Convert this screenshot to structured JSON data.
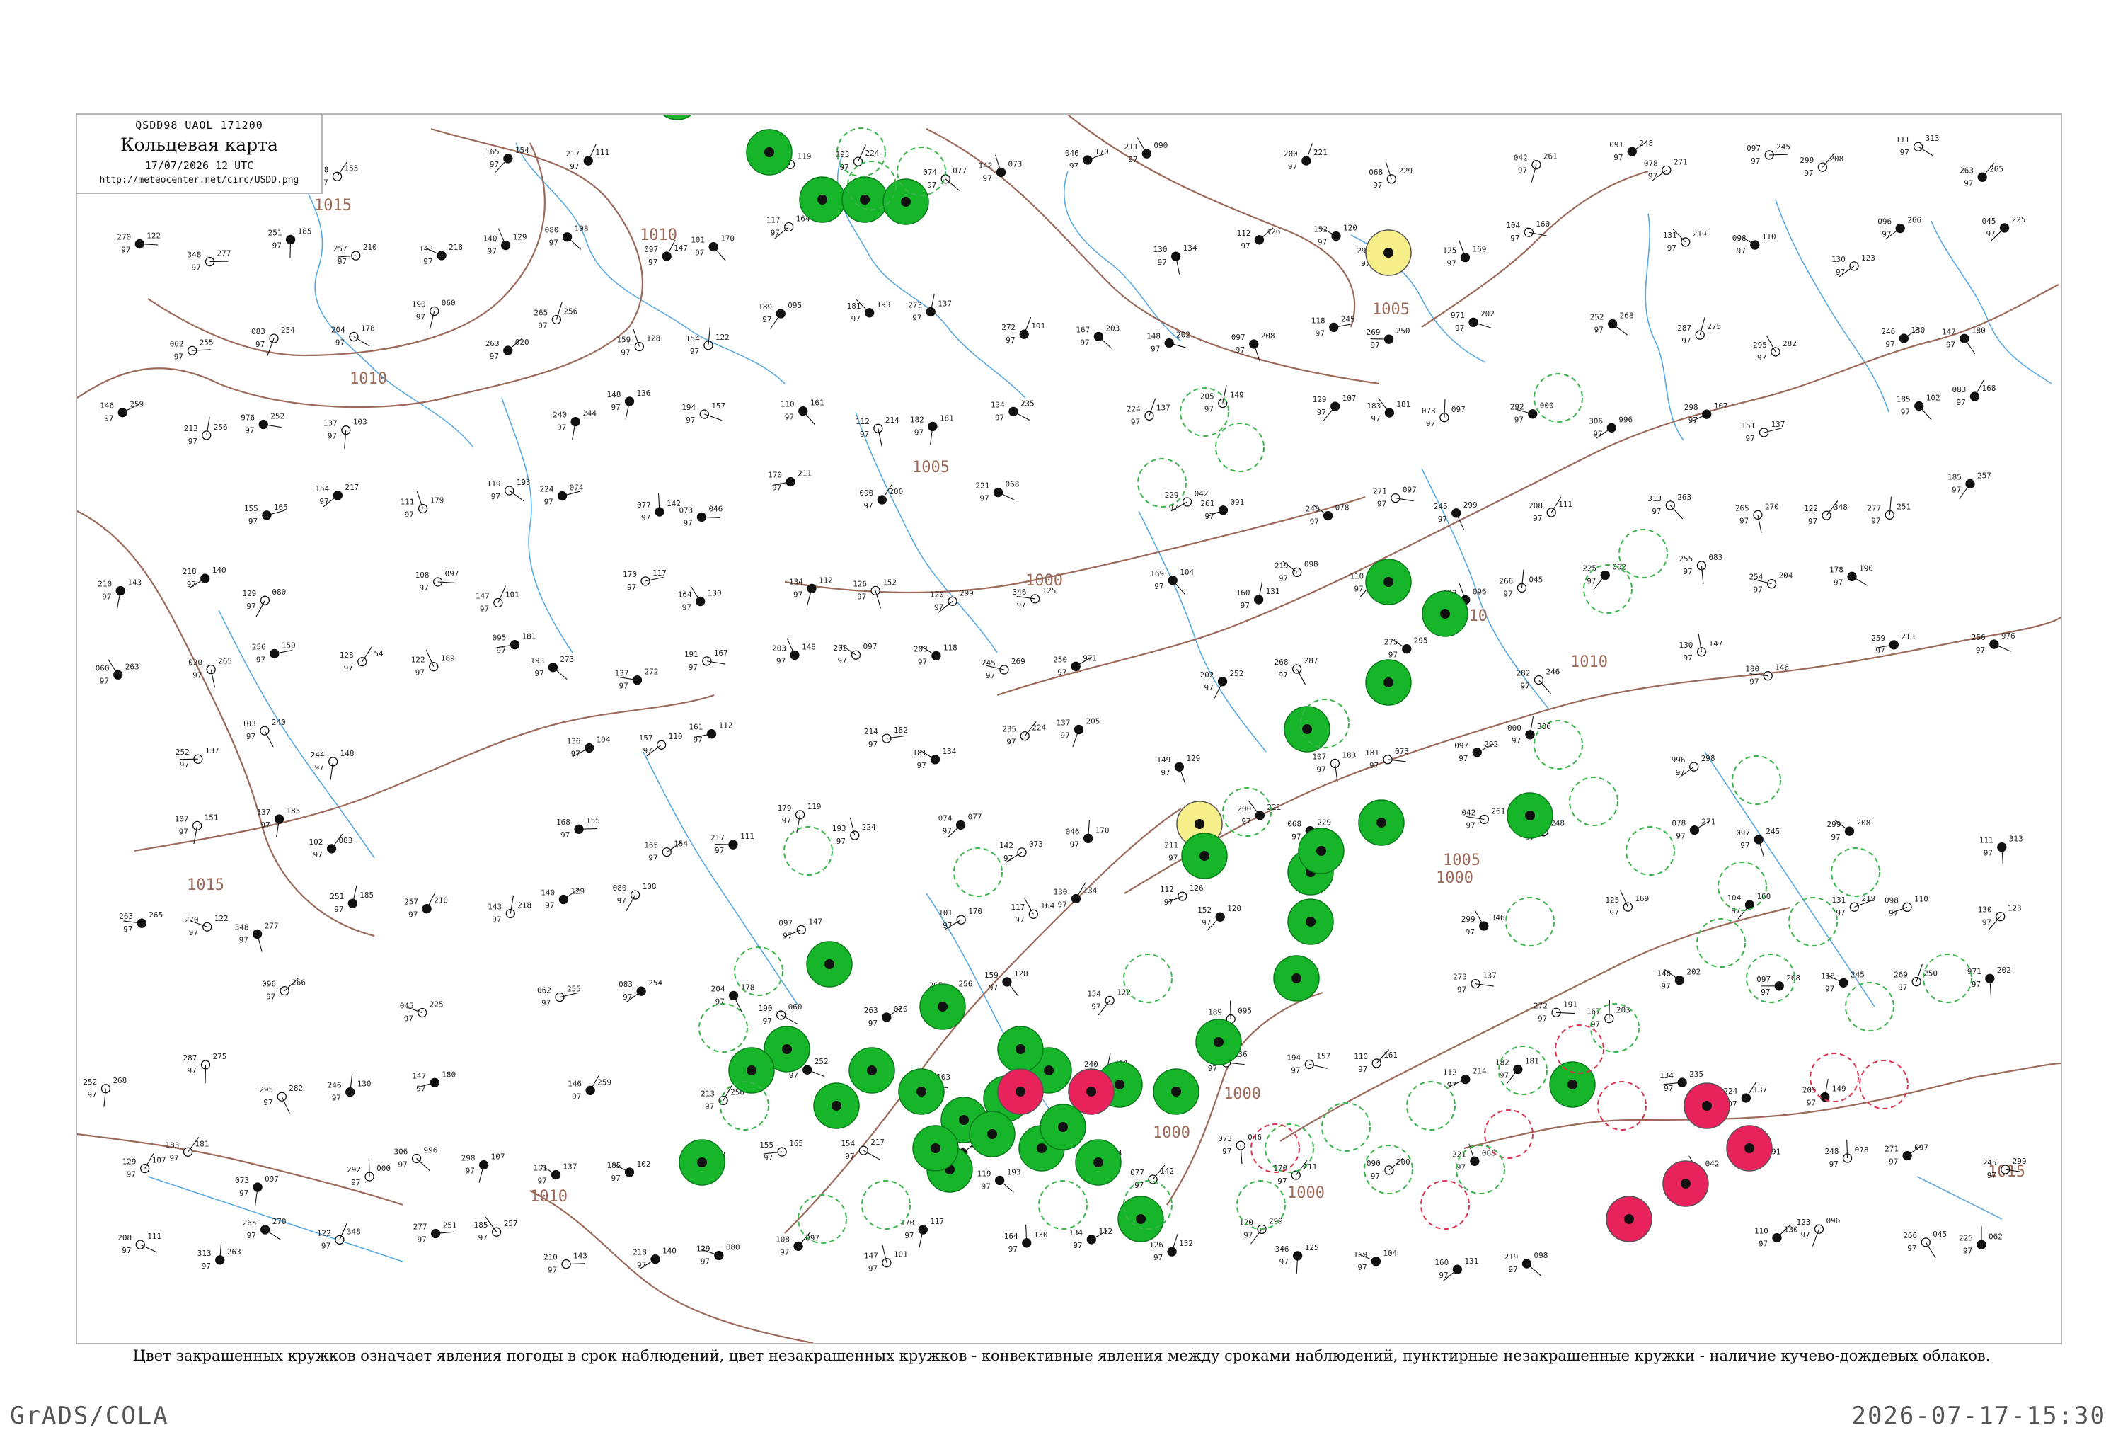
{
  "header": {
    "code": "QSDD98  UAOL  171200",
    "title": "Кольцевая карта",
    "datetime": "17/07/2026 12 UTC",
    "url": "http://meteocenter.net/circ/USDD.png"
  },
  "caption": "Цвет закрашенных кружков означает явления погоды в срок наблюдений, цвет незакрашенных кружков - конвективные явления между сроками наблюдений, пунктирные незакрашенные кружки - наличие кучево-дождевых облаков.",
  "footer": {
    "left": "GrADS/COLA",
    "right": "2026-07-17-15:30"
  },
  "colors": {
    "isobar": "#9b6a5a",
    "river": "#5aa9e0",
    "green_fill": "#17b52a",
    "red_fill": "#e8225a",
    "yellow_fill": "#f7f08a",
    "cyan_fill": "#3de0c8",
    "green_dashed": "#39b54a",
    "red_dashed": "#d9334f"
  },
  "isobar_labels": [
    "1015",
    "1010",
    "1010",
    "1005",
    "1010",
    "1010",
    "1005",
    "1000",
    "1015",
    "1015",
    "1010",
    "1005",
    "1000",
    "1000",
    "1000",
    "1000",
    "1015"
  ],
  "station_values": [
    "107",
    "151",
    "137",
    "185",
    "102",
    "083",
    "168",
    "155",
    "165",
    "154",
    "217",
    "111",
    "179",
    "119",
    "193",
    "224",
    "074",
    "077",
    "142",
    "073",
    "046",
    "170",
    "211",
    "090",
    "200",
    "221",
    "068",
    "229",
    "042",
    "261",
    "091",
    "248",
    "078",
    "271",
    "097",
    "245",
    "299",
    "208",
    "111",
    "313",
    "263",
    "265",
    "270",
    "122",
    "348",
    "277",
    "251",
    "185",
    "257",
    "210",
    "143",
    "218",
    "140",
    "129",
    "080",
    "108",
    "097",
    "147",
    "101",
    "170",
    "117",
    "164",
    "130",
    "134",
    "112",
    "126",
    "152",
    "120",
    "299",
    "346",
    "125",
    "169",
    "104",
    "160",
    "131",
    "219",
    "098",
    "110",
    "130",
    "123",
    "096",
    "266",
    "045",
    "225",
    "062",
    "255",
    "083",
    "254",
    "204",
    "178",
    "190",
    "060",
    "263",
    "020",
    "265",
    "256",
    "159",
    "128",
    "154",
    "122",
    "189",
    "095",
    "181",
    "193",
    "273",
    "137",
    "272",
    "191",
    "167",
    "203",
    "148",
    "202",
    "097",
    "208",
    "118",
    "245",
    "269",
    "250",
    "971",
    "202",
    "252",
    "268",
    "287",
    "275",
    "295",
    "282",
    "246",
    "130",
    "147",
    "180",
    "146",
    "259",
    "213",
    "256",
    "976",
    "252",
    "137",
    "103",
    "240",
    "244",
    "148",
    "136",
    "194",
    "157",
    "110",
    "161",
    "112",
    "214",
    "182",
    "181",
    "134",
    "235",
    "224",
    "137",
    "205",
    "149",
    "129",
    "107",
    "183",
    "181",
    "073",
    "097",
    "292",
    "000",
    "306",
    "996",
    "298"
  ]
}
